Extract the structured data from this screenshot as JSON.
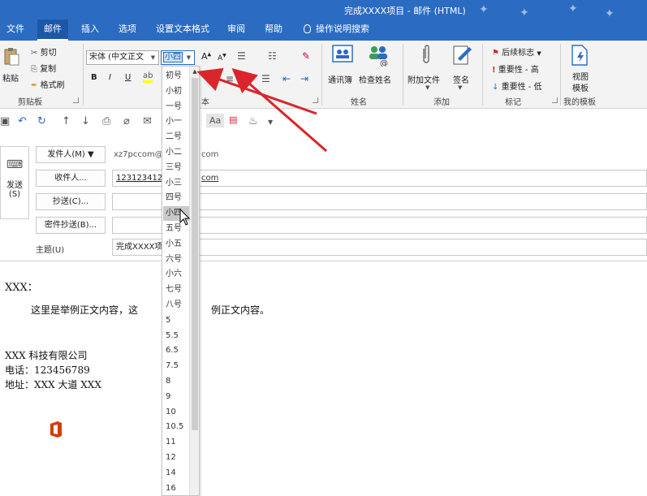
{
  "window": {
    "title": "完成XXXX项目 - 邮件 (HTML)"
  },
  "tabs": [
    "文件",
    "邮件",
    "插入",
    "选项",
    "设置文本格式",
    "审阅",
    "帮助",
    "操作说明搜索"
  ],
  "ribbon": {
    "clipboard": {
      "paste": "粘贴",
      "cut": "剪切",
      "copy": "复制",
      "format_painter": "格式刷",
      "label": "剪贴板"
    },
    "font": {
      "name": "宋体 (中文正文",
      "size": "小四",
      "bold": "B",
      "italic": "I",
      "underline": "U",
      "grow": "A",
      "shrink": "A",
      "label": "本"
    },
    "names": {
      "address_book": "通讯簿",
      "check_names": "检查姓名",
      "label": "姓名"
    },
    "include": {
      "attach": "附加文件",
      "signature": "签名",
      "label": "添加"
    },
    "tags": {
      "followup": "后续标志",
      "high": "重要性 - 高",
      "low": "重要性 - 低",
      "label": "标记"
    },
    "templates": {
      "view": "视图",
      "view2": "模板",
      "label": "我的模板"
    }
  },
  "qat": {
    "aa": "Aa"
  },
  "header": {
    "send": "发送",
    "send_key": "(S)",
    "from_btn": "发件人(M) ▼",
    "from_value": "xz7pccom@",
    "from_value_tail": "com",
    "to_btn": "收件人...",
    "to_value": "123123412",
    "to_value_tail": "com",
    "cc_btn": "抄送(C)...",
    "bcc_btn": "密件抄送(B)...",
    "subject_label": "主题(U)",
    "subject_value": "完成XXXX项"
  },
  "body": {
    "greeting": "XXX：",
    "line1a": "这里是举例正文内容，这",
    "line1b": "例正文内容。",
    "sig1": "XXX 科技有限公司",
    "sig2": "电话：123456789",
    "sig3": "地址：XXX 大道 XXX"
  },
  "font_sizes": [
    "初号",
    "小初",
    "一号",
    "小一",
    "二号",
    "小二",
    "三号",
    "小三",
    "四号",
    "小四",
    "五号",
    "小五",
    "六号",
    "小六",
    "七号",
    "八号",
    "5",
    "5.5",
    "6.5",
    "7.5",
    "8",
    "9",
    "10",
    "10.5",
    "11",
    "12",
    "14",
    "16"
  ],
  "highlighted_size": "小四",
  "colors": {
    "accent": "#2b6cc2",
    "arrow": "#d9262b",
    "office": "#d83b01"
  }
}
